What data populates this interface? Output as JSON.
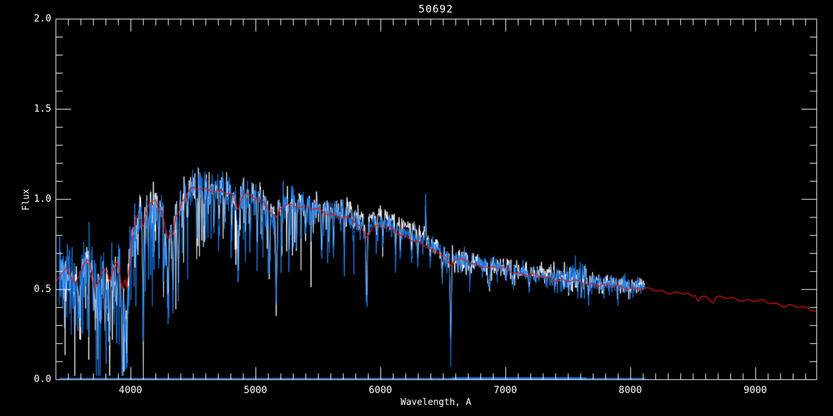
{
  "title": "50692",
  "colors": {
    "background": "#000000",
    "axis": "#ffffff",
    "observed": "#1b7ff0",
    "comparison": "#ffffff",
    "template": "#e61410"
  },
  "chart_data": {
    "type": "line",
    "title": "50692",
    "xlabel": "Wavelength, A",
    "ylabel": "Flux",
    "xlim": [
      3400,
      9489
    ],
    "ylim": [
      0.0,
      2.0
    ],
    "x_major_ticks": [
      4000,
      5000,
      6000,
      7000,
      8000,
      9000
    ],
    "x_tick_labels": [
      "4000",
      "5000",
      "6000",
      "7000",
      "8000",
      "9000"
    ],
    "x_minor_step": 100,
    "y_major_ticks": [
      0.0,
      0.5,
      1.0,
      1.5,
      2.0
    ],
    "y_tick_labels": [
      "0.0",
      "0.5",
      "1.0",
      "1.5",
      "2.0"
    ],
    "y_minor_step": 0.1,
    "grid": false,
    "legend": null,
    "description": "Stellar spectrum 50692: observed spectrum (blue), comparison spectrum (white), fitted template (red), zero/noise level line (blue) at flux ~0",
    "template_series": {
      "name": "template-fit",
      "color": "#e61410",
      "points": [
        [
          3400,
          0.545
        ],
        [
          3430,
          0.565
        ],
        [
          3460,
          0.59
        ],
        [
          3490,
          0.625
        ],
        [
          3510,
          0.6
        ],
        [
          3530,
          0.565
        ],
        [
          3555,
          0.53
        ],
        [
          3580,
          0.555
        ],
        [
          3605,
          0.6
        ],
        [
          3630,
          0.645
        ],
        [
          3655,
          0.66
        ],
        [
          3675,
          0.635
        ],
        [
          3695,
          0.575
        ],
        [
          3715,
          0.51
        ],
        [
          3735,
          0.525
        ],
        [
          3760,
          0.575
        ],
        [
          3785,
          0.615
        ],
        [
          3810,
          0.6
        ],
        [
          3835,
          0.545
        ],
        [
          3860,
          0.615
        ],
        [
          3885,
          0.655
        ],
        [
          3905,
          0.625
        ],
        [
          3925,
          0.52
        ],
        [
          3940,
          0.49
        ],
        [
          3955,
          0.565
        ],
        [
          3968,
          0.51
        ],
        [
          3980,
          0.56
        ],
        [
          4000,
          0.68
        ],
        [
          4020,
          0.8
        ],
        [
          4045,
          0.9
        ],
        [
          4070,
          0.925
        ],
        [
          4085,
          0.89
        ],
        [
          4101,
          0.845
        ],
        [
          4120,
          0.91
        ],
        [
          4145,
          0.965
        ],
        [
          4175,
          0.99
        ],
        [
          4205,
          1.0
        ],
        [
          4227,
          0.93
        ],
        [
          4255,
          0.92
        ],
        [
          4275,
          0.84
        ],
        [
          4300,
          0.775
        ],
        [
          4318,
          0.82
        ],
        [
          4340,
          0.8
        ],
        [
          4362,
          0.9
        ],
        [
          4383,
          0.92
        ],
        [
          4410,
          0.99
        ],
        [
          4440,
          1.02
        ],
        [
          4470,
          1.045
        ],
        [
          4500,
          1.06
        ],
        [
          4540,
          1.055
        ],
        [
          4580,
          1.05
        ],
        [
          4620,
          1.05
        ],
        [
          4660,
          1.045
        ],
        [
          4700,
          1.05
        ],
        [
          4740,
          1.045
        ],
        [
          4780,
          1.035
        ],
        [
          4820,
          1.02
        ],
        [
          4861,
          0.93
        ],
        [
          4885,
          1.0
        ],
        [
          4910,
          1.025
        ],
        [
          4940,
          1.02
        ],
        [
          4970,
          1.015
        ],
        [
          5000,
          1.01
        ],
        [
          5030,
          1.0
        ],
        [
          5060,
          0.985
        ],
        [
          5090,
          0.955
        ],
        [
          5110,
          0.935
        ],
        [
          5140,
          0.91
        ],
        [
          5167,
          0.885
        ],
        [
          5190,
          0.93
        ],
        [
          5220,
          0.965
        ],
        [
          5250,
          0.975
        ],
        [
          5280,
          0.97
        ],
        [
          5310,
          0.965
        ],
        [
          5340,
          0.96
        ],
        [
          5380,
          0.955
        ],
        [
          5420,
          0.95
        ],
        [
          5460,
          0.945
        ],
        [
          5500,
          0.94
        ],
        [
          5540,
          0.93
        ],
        [
          5580,
          0.92
        ],
        [
          5620,
          0.915
        ],
        [
          5660,
          0.905
        ],
        [
          5700,
          0.9
        ],
        [
          5740,
          0.89
        ],
        [
          5780,
          0.88
        ],
        [
          5820,
          0.86
        ],
        [
          5860,
          0.825
        ],
        [
          5890,
          0.79
        ],
        [
          5915,
          0.825
        ],
        [
          5940,
          0.85
        ],
        [
          5970,
          0.85
        ],
        [
          6000,
          0.845
        ],
        [
          6040,
          0.84
        ],
        [
          6080,
          0.835
        ],
        [
          6122,
          0.815
        ],
        [
          6160,
          0.805
        ],
        [
          6200,
          0.795
        ],
        [
          6240,
          0.78
        ],
        [
          6280,
          0.765
        ],
        [
          6320,
          0.75
        ],
        [
          6360,
          0.735
        ],
        [
          6400,
          0.72
        ],
        [
          6440,
          0.71
        ],
        [
          6480,
          0.7
        ],
        [
          6510,
          0.69
        ],
        [
          6535,
          0.665
        ],
        [
          6563,
          0.625
        ],
        [
          6590,
          0.665
        ],
        [
          6620,
          0.665
        ],
        [
          6660,
          0.655
        ],
        [
          6700,
          0.65
        ],
        [
          6750,
          0.64
        ],
        [
          6800,
          0.635
        ],
        [
          6850,
          0.625
        ],
        [
          6870,
          0.615
        ],
        [
          6900,
          0.62
        ],
        [
          6950,
          0.615
        ],
        [
          7000,
          0.61
        ],
        [
          7050,
          0.6
        ],
        [
          7100,
          0.59
        ],
        [
          7150,
          0.585
        ],
        [
          7200,
          0.578
        ],
        [
          7250,
          0.572
        ],
        [
          7300,
          0.565
        ],
        [
          7350,
          0.56
        ],
        [
          7400,
          0.555
        ],
        [
          7450,
          0.55
        ],
        [
          7500,
          0.546
        ],
        [
          7550,
          0.542
        ],
        [
          7600,
          0.536
        ],
        [
          7650,
          0.532
        ],
        [
          7700,
          0.528
        ],
        [
          7750,
          0.524
        ],
        [
          7800,
          0.52
        ],
        [
          7850,
          0.517
        ],
        [
          7900,
          0.514
        ],
        [
          7950,
          0.511
        ],
        [
          8000,
          0.508
        ],
        [
          8050,
          0.505
        ],
        [
          8100,
          0.5
        ],
        [
          8150,
          0.497
        ],
        [
          8200,
          0.493
        ],
        [
          8250,
          0.489
        ],
        [
          8300,
          0.485
        ],
        [
          8350,
          0.48
        ],
        [
          8400,
          0.477
        ],
        [
          8450,
          0.472
        ],
        [
          8498,
          0.452
        ],
        [
          8520,
          0.468
        ],
        [
          8542,
          0.437
        ],
        [
          8565,
          0.463
        ],
        [
          8600,
          0.458
        ],
        [
          8630,
          0.452
        ],
        [
          8662,
          0.428
        ],
        [
          8690,
          0.452
        ],
        [
          8730,
          0.452
        ],
        [
          8780,
          0.449
        ],
        [
          8830,
          0.446
        ],
        [
          8880,
          0.443
        ],
        [
          8930,
          0.44
        ],
        [
          8980,
          0.436
        ],
        [
          9030,
          0.432
        ],
        [
          9080,
          0.428
        ],
        [
          9130,
          0.423
        ],
        [
          9180,
          0.418
        ],
        [
          9230,
          0.412
        ],
        [
          9280,
          0.407
        ],
        [
          9330,
          0.401
        ],
        [
          9400,
          0.394
        ],
        [
          9489,
          0.385
        ]
      ]
    },
    "noisy_series": [
      {
        "name": "comparison-spectrum",
        "color": "#ffffff",
        "lambda_range": [
          3430,
          8120
        ],
        "sample_step": 3.1,
        "seed": 87431,
        "line_scale": 0.85,
        "forest_gain": 1.15,
        "offset": [
          [
            3430,
            0.0
          ],
          [
            4300,
            0.015
          ],
          [
            5000,
            0.025
          ],
          [
            5600,
            0.04
          ],
          [
            5900,
            0.065
          ],
          [
            6350,
            0.065
          ],
          [
            6500,
            0.01
          ],
          [
            6900,
            0.0
          ],
          [
            7300,
            0.03
          ],
          [
            7700,
            0.025
          ],
          [
            8120,
            0.02
          ]
        ],
        "noise_sigma": [
          [
            3430,
            0.055
          ],
          [
            3950,
            0.06
          ],
          [
            4050,
            0.045
          ],
          [
            4500,
            0.04
          ],
          [
            5000,
            0.035
          ],
          [
            5600,
            0.03
          ],
          [
            5900,
            0.022
          ],
          [
            6300,
            0.02
          ],
          [
            6500,
            0.03
          ],
          [
            7000,
            0.028
          ],
          [
            7300,
            0.025
          ],
          [
            7570,
            0.04
          ],
          [
            7700,
            0.022
          ],
          [
            8120,
            0.02
          ]
        ]
      },
      {
        "name": "observed-spectrum",
        "color": "#1b7ff0",
        "lambda_range": [
          3430,
          8120
        ],
        "sample_step": 2.8,
        "seed": 20692,
        "line_scale": 1.0,
        "forest_gain": 1.0,
        "offset": [
          [
            3430,
            0.0
          ],
          [
            5600,
            0.01
          ],
          [
            5900,
            0.02
          ],
          [
            6300,
            0.02
          ],
          [
            6500,
            0.015
          ],
          [
            7000,
            0.01
          ],
          [
            8120,
            0.01
          ]
        ],
        "noise_sigma": [
          [
            3430,
            0.085
          ],
          [
            3700,
            0.1
          ],
          [
            3950,
            0.1
          ],
          [
            4050,
            0.065
          ],
          [
            4300,
            0.055
          ],
          [
            4700,
            0.05
          ],
          [
            5200,
            0.045
          ],
          [
            5600,
            0.04
          ],
          [
            5900,
            0.03
          ],
          [
            6300,
            0.025
          ],
          [
            6800,
            0.022
          ],
          [
            7300,
            0.02
          ],
          [
            7570,
            0.05
          ],
          [
            7700,
            0.025
          ],
          [
            8120,
            0.02
          ]
        ]
      }
    ],
    "absorption_lines": [
      [
        3587,
        0.22,
        5
      ],
      [
        3727,
        0.22,
        5
      ],
      [
        3760,
        0.25,
        5
      ],
      [
        3798,
        0.28,
        5
      ],
      [
        3835,
        0.3,
        5
      ],
      [
        3869,
        0.22,
        4
      ],
      [
        3889,
        0.3,
        5
      ],
      [
        3933,
        0.42,
        5
      ],
      [
        3955,
        0.4,
        4
      ],
      [
        3970,
        0.45,
        5
      ],
      [
        4045,
        0.18,
        4
      ],
      [
        4101,
        0.38,
        5
      ],
      [
        4144,
        0.22,
        4
      ],
      [
        4172,
        0.2,
        4
      ],
      [
        4227,
        0.32,
        4
      ],
      [
        4271,
        0.22,
        4
      ],
      [
        4300,
        0.45,
        6
      ],
      [
        4340,
        0.38,
        4
      ],
      [
        4383,
        0.38,
        4
      ],
      [
        4415,
        0.22,
        4
      ],
      [
        4455,
        0.22,
        4
      ],
      [
        4531,
        0.28,
        4
      ],
      [
        4583,
        0.24,
        4
      ],
      [
        4620,
        0.18,
        4
      ],
      [
        4668,
        0.28,
        4
      ],
      [
        4710,
        0.18,
        4
      ],
      [
        4754,
        0.2,
        4
      ],
      [
        4810,
        0.18,
        4
      ],
      [
        4861,
        0.42,
        5
      ],
      [
        4920,
        0.28,
        4
      ],
      [
        4957,
        0.22,
        4
      ],
      [
        5015,
        0.26,
        4
      ],
      [
        5051,
        0.2,
        4
      ],
      [
        5110,
        0.4,
        5
      ],
      [
        5167,
        0.52,
        6
      ],
      [
        5210,
        0.28,
        4
      ],
      [
        5270,
        0.32,
        4
      ],
      [
        5328,
        0.28,
        4
      ],
      [
        5400,
        0.24,
        4
      ],
      [
        5445,
        0.18,
        4
      ],
      [
        5530,
        0.28,
        5
      ],
      [
        5590,
        0.2,
        4
      ],
      [
        5625,
        0.22,
        4
      ],
      [
        5710,
        0.18,
        4
      ],
      [
        5782,
        0.16,
        4
      ],
      [
        5890,
        0.48,
        5
      ],
      [
        5970,
        0.16,
        4
      ],
      [
        6020,
        0.12,
        4
      ],
      [
        6122,
        0.2,
        4
      ],
      [
        6160,
        0.16,
        4
      ],
      [
        6250,
        0.16,
        4
      ],
      [
        6300,
        0.16,
        4
      ],
      [
        6400,
        0.12,
        4
      ],
      [
        6495,
        0.16,
        4
      ],
      [
        6563,
        0.46,
        5
      ],
      [
        6620,
        0.1,
        3
      ],
      [
        6717,
        0.12,
        4
      ],
      [
        6870,
        0.14,
        5
      ],
      [
        7000,
        0.08,
        4
      ],
      [
        7055,
        0.08,
        4
      ],
      [
        7190,
        0.1,
        5
      ],
      [
        7245,
        0.08,
        4
      ],
      [
        7400,
        0.08,
        4
      ],
      [
        7510,
        0.07,
        4
      ],
      [
        7605,
        0.12,
        6
      ],
      [
        7665,
        0.1,
        5
      ],
      [
        7775,
        0.07,
        4
      ],
      [
        7900,
        0.06,
        4
      ],
      [
        8000,
        0.06,
        4
      ]
    ],
    "emission_spikes": {
      "observed-spectrum": [
        [
          6362,
          0.24,
          2.5
        ],
        [
          7600,
          0.16,
          3
        ],
        [
          7618,
          0.13,
          3
        ],
        [
          7640,
          0.1,
          3
        ],
        [
          8060,
          0.05,
          3
        ]
      ],
      "comparison-spectrum": [
        [
          6362,
          0.22,
          2.5
        ],
        [
          7600,
          0.08,
          3
        ]
      ]
    },
    "forest": {
      "probability": [
        [
          3430,
          0.3
        ],
        [
          3900,
          0.33
        ],
        [
          4000,
          0.25
        ],
        [
          4300,
          0.22
        ],
        [
          4800,
          0.16
        ],
        [
          5400,
          0.13
        ],
        [
          5800,
          0.1
        ],
        [
          6300,
          0.07
        ],
        [
          6900,
          0.06
        ],
        [
          7500,
          0.06
        ],
        [
          8120,
          0.06
        ]
      ],
      "mean_depth": [
        [
          3430,
          0.13
        ],
        [
          3900,
          0.14
        ],
        [
          4000,
          0.12
        ],
        [
          4300,
          0.11
        ],
        [
          4800,
          0.09
        ],
        [
          5400,
          0.08
        ],
        [
          5800,
          0.05
        ],
        [
          6300,
          0.04
        ],
        [
          6900,
          0.035
        ],
        [
          7500,
          0.03
        ],
        [
          8120,
          0.03
        ]
      ]
    },
    "baseline": {
      "name": "zero-level-line",
      "color": "#1b7ff0",
      "flux": 0.005,
      "lambda_range": [
        3430,
        8120
      ],
      "bold_range": [
        6570,
        7650
      ]
    }
  }
}
